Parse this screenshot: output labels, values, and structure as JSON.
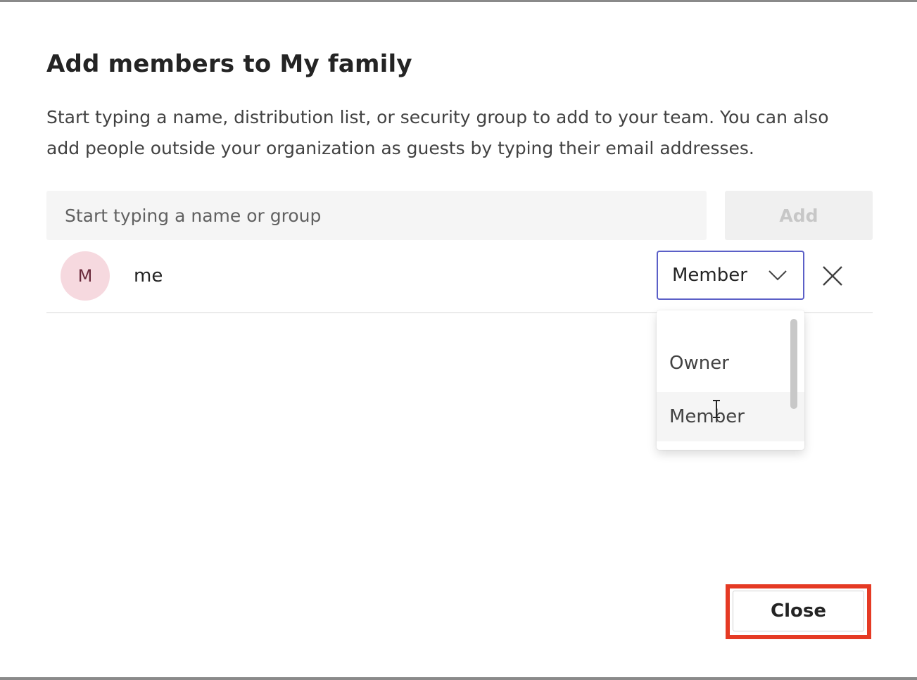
{
  "dialog": {
    "title": "Add members to My family",
    "description": "Start typing a name, distribution list, or security group to add to your team. You can also add people outside your organization as guests by typing their email addresses."
  },
  "search": {
    "placeholder": "Start typing a name or group",
    "value": ""
  },
  "add_button": {
    "label": "Add",
    "state": "disabled"
  },
  "members": [
    {
      "initial": "M",
      "name": "me",
      "role": "Member"
    }
  ],
  "role_dropdown": {
    "options": [
      "Owner",
      "Member"
    ],
    "hovered": "Member"
  },
  "close_button": {
    "label": "Close"
  },
  "colors": {
    "accent": "#5b5fc7",
    "highlight": "#e53a24",
    "avatar_bg": "#f6d9df",
    "avatar_text": "#6b2a3c"
  },
  "icons": {
    "chevron": "chevron-down-icon",
    "remove": "close-icon",
    "cursor": "text-cursor-icon"
  }
}
